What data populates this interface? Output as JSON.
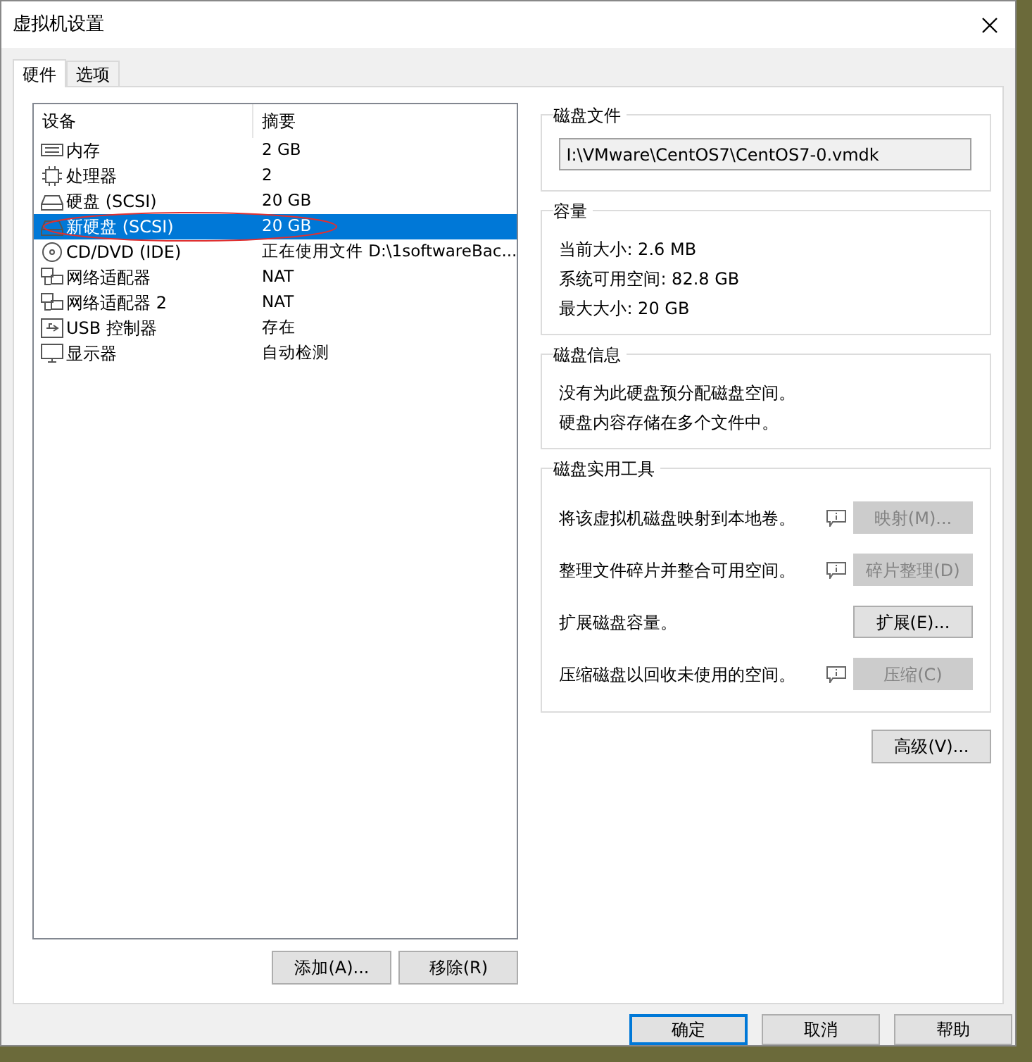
{
  "window": {
    "title": "虚拟机设置"
  },
  "tabs": [
    {
      "label": "硬件",
      "selected": true
    },
    {
      "label": "选项",
      "selected": false
    }
  ],
  "device_table": {
    "columns": [
      "设备",
      "摘要"
    ],
    "rows": [
      {
        "kind": "memory",
        "device": "内存",
        "summary": "2 GB",
        "selected": false
      },
      {
        "kind": "cpu",
        "device": "处理器",
        "summary": "2",
        "selected": false
      },
      {
        "kind": "disk",
        "device": "硬盘 (SCSI)",
        "summary": "20 GB",
        "selected": false
      },
      {
        "kind": "disk",
        "device": "新硬盘 (SCSI)",
        "summary": "20 GB",
        "selected": true
      },
      {
        "kind": "cd",
        "device": "CD/DVD (IDE)",
        "summary": "正在使用文件 D:\\1softwareBac...",
        "selected": false
      },
      {
        "kind": "network",
        "device": "网络适配器",
        "summary": "NAT",
        "selected": false
      },
      {
        "kind": "network",
        "device": "网络适配器 2",
        "summary": "NAT",
        "selected": false
      },
      {
        "kind": "usb",
        "device": "USB 控制器",
        "summary": "存在",
        "selected": false
      },
      {
        "kind": "display",
        "device": "显示器",
        "summary": "自动检测",
        "selected": false
      }
    ]
  },
  "list_buttons": [
    {
      "label": "添加(A)..."
    },
    {
      "label": "移除(R)"
    }
  ],
  "disk_file": {
    "title": "磁盘文件",
    "value": "I:\\VMware\\CentOS7\\CentOS7-0.vmdk"
  },
  "capacity": {
    "title": "容量",
    "lines": [
      "当前大小: 2.6 MB",
      "系统可用空间: 82.8 GB",
      "最大大小: 20 GB"
    ]
  },
  "disk_info": {
    "title": "磁盘信息",
    "lines": [
      "没有为此硬盘预分配磁盘空间。",
      "硬盘内容存储在多个文件中。"
    ]
  },
  "disk_utilities": {
    "title": "磁盘实用工具",
    "rows": [
      {
        "text": "将该虚拟机磁盘映射到本地卷。",
        "info": true,
        "button": "映射(M)...",
        "disabled": true
      },
      {
        "text": "整理文件碎片并整合可用空间。",
        "info": true,
        "button": "碎片整理(D)",
        "disabled": true
      },
      {
        "text": "扩展磁盘容量。",
        "info": false,
        "button": "扩展(E)...",
        "disabled": false
      },
      {
        "text": "压缩磁盘以回收未使用的空间。",
        "info": true,
        "button": "压缩(C)",
        "disabled": true
      }
    ]
  },
  "advanced_button": "高级(V)...",
  "dialog_buttons": [
    {
      "label": "确定",
      "default": true
    },
    {
      "label": "取消",
      "default": false
    },
    {
      "label": "帮助",
      "default": false
    }
  ]
}
